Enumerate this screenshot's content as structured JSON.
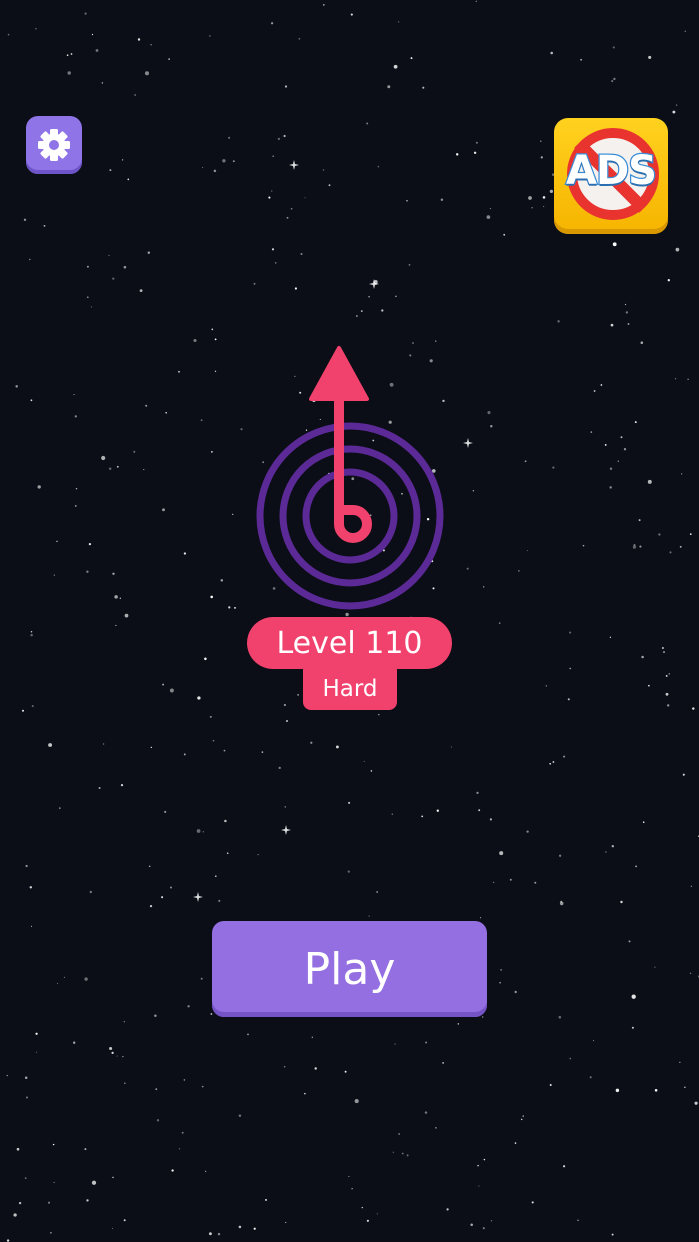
{
  "level": {
    "label": "Level 110",
    "difficulty": "Hard"
  },
  "buttons": {
    "play_label": "Play",
    "ads_label": "ADS",
    "settings_icon": "gear-icon"
  },
  "colors": {
    "background": "#0b0e16",
    "accent_pink": "#f1416d",
    "accent_purple": "#946fe2",
    "spiral_purple": "#5c2a97",
    "ads_yellow": "#ffd21f",
    "ads_red": "#e8332f"
  }
}
